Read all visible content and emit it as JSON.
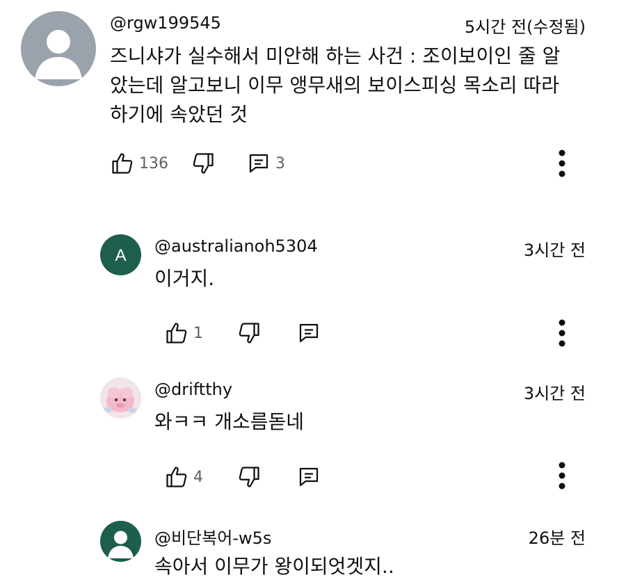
{
  "comments": [
    {
      "author": "@rgw199545",
      "time": "5시간 전(수정됨)",
      "text_lines": [
        "즈니샤가 실수해서 미안해 하는 사건 : 조이보이인 줄 알",
        "았는데 알고보니 이무 앵무새의 보이스피싱 목소리 따라",
        "하기에 속았던 것"
      ],
      "likes": "136",
      "replies": "3"
    }
  ],
  "replies": [
    {
      "author": "@australianoh5304",
      "time": "3시간 전",
      "text": "이거지.",
      "likes": "1",
      "avatar_letter": "A",
      "avatar_color": "#1e5e4c"
    },
    {
      "author": "@driftthy",
      "time": "3시간 전",
      "text": "와ㅋㅋ 개소름돋네",
      "likes": "4"
    },
    {
      "author": "@비단복어-w5s",
      "time": "26분 전",
      "text": "속아서 이무가 왕이되엇겟지..",
      "avatar_color": "#1e5e4c"
    }
  ],
  "icons": {
    "like": "thumb-up-icon",
    "dislike": "thumb-down-icon",
    "reply": "reply-comment-icon",
    "more": "more-vert-icon"
  },
  "colors": {
    "text": "#0f0f0f",
    "secondary": "#606060",
    "default_avatar_bg": "#9aa2ab"
  }
}
